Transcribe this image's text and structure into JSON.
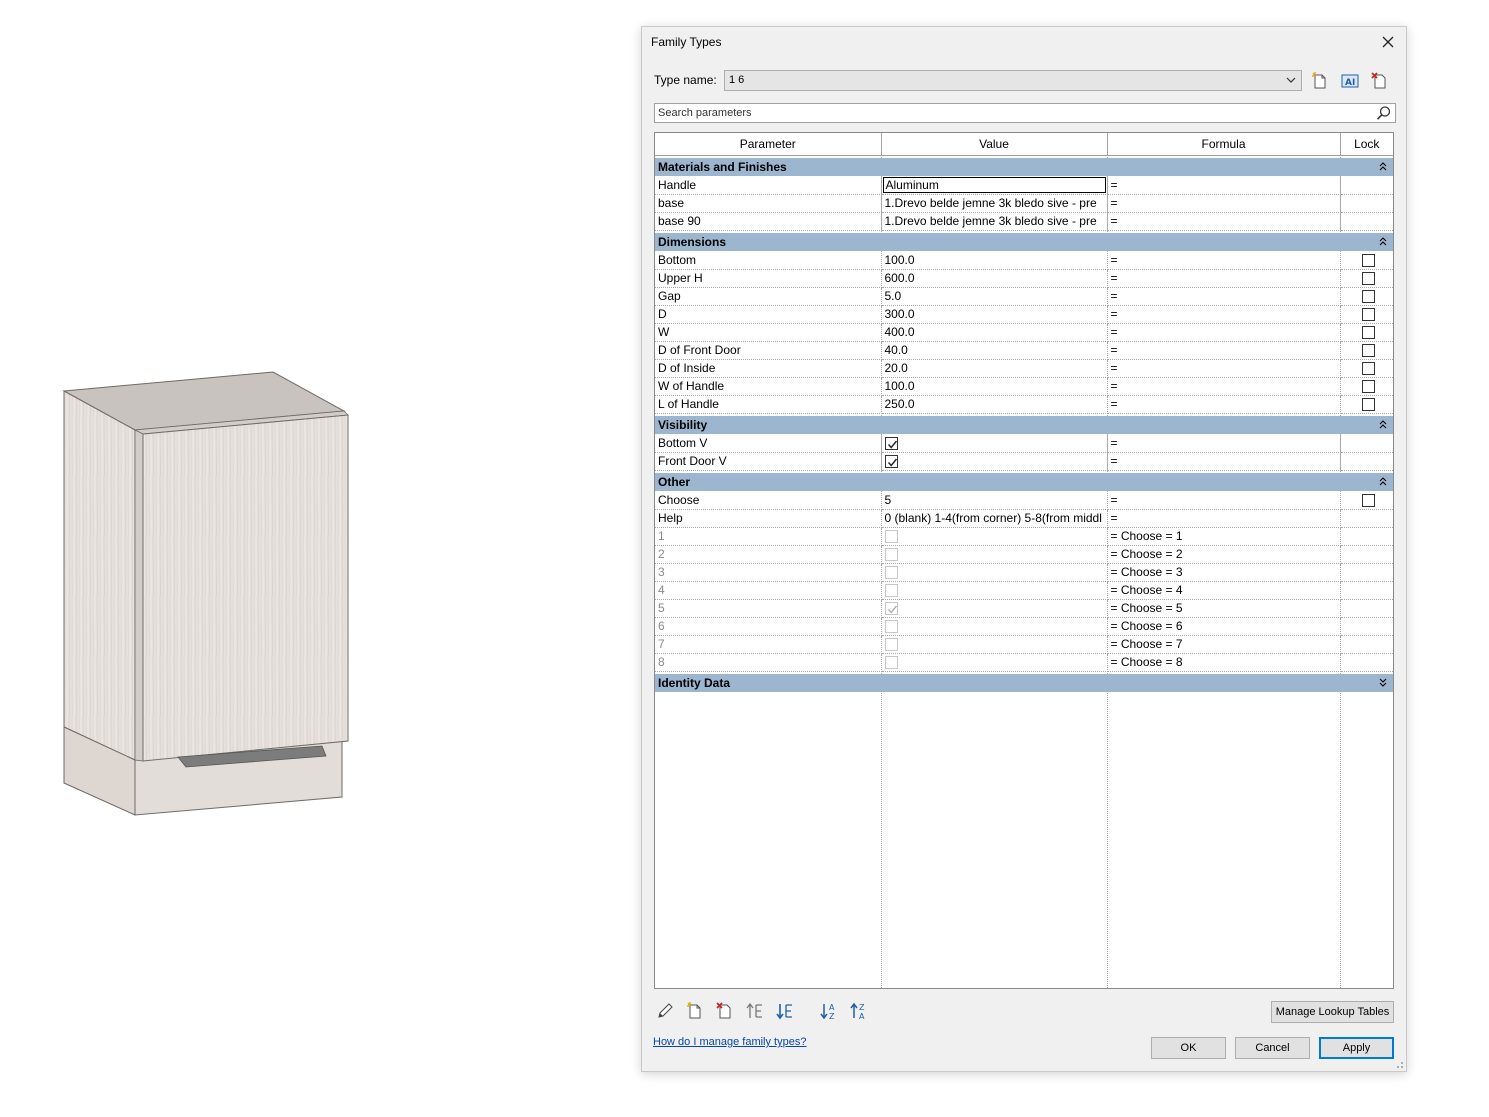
{
  "dialog": {
    "title": "Family Types",
    "type_name_label": "Type name:",
    "type_name_value": "1 6",
    "search_placeholder": "Search parameters"
  },
  "columns": {
    "parameter": "Parameter",
    "value": "Value",
    "formula": "Formula",
    "lock": "Lock"
  },
  "groups": {
    "materials": "Materials and Finishes",
    "dimensions": "Dimensions",
    "visibility": "Visibility",
    "other": "Other",
    "identity": "Identity Data"
  },
  "materials": [
    {
      "name": "Handle",
      "value": "Aluminum",
      "formula": "="
    },
    {
      "name": "base",
      "value": "1.Drevo belde jemne 3k bledo sive - pre",
      "formula": "="
    },
    {
      "name": "base 90",
      "value": "1.Drevo belde jemne 3k bledo sive - pre",
      "formula": "="
    }
  ],
  "dimensions": [
    {
      "name": "Bottom",
      "value": "100.0",
      "formula": "="
    },
    {
      "name": "Upper H",
      "value": "600.0",
      "formula": "="
    },
    {
      "name": "Gap",
      "value": "5.0",
      "formula": "="
    },
    {
      "name": "D",
      "value": "300.0",
      "formula": "="
    },
    {
      "name": "W",
      "value": "400.0",
      "formula": "="
    },
    {
      "name": "D of Front Door",
      "value": "40.0",
      "formula": "="
    },
    {
      "name": "D of Inside",
      "value": "20.0",
      "formula": "="
    },
    {
      "name": "W of Handle",
      "value": "100.0",
      "formula": "="
    },
    {
      "name": "L of Handle",
      "value": "250.0",
      "formula": "="
    }
  ],
  "visibility": [
    {
      "name": "Bottom V",
      "checked": true,
      "formula": "="
    },
    {
      "name": "Front Door V",
      "checked": true,
      "formula": "="
    }
  ],
  "other": {
    "choose": {
      "name": "Choose",
      "value": "5",
      "formula": "="
    },
    "help": {
      "name": "Help",
      "value": "0 (blank) 1-4(from corner) 5-8(from middl",
      "formula": "="
    },
    "options": [
      {
        "name": "1",
        "checked": false,
        "formula": "= Choose = 1"
      },
      {
        "name": "2",
        "checked": false,
        "formula": "= Choose = 2"
      },
      {
        "name": "3",
        "checked": false,
        "formula": "= Choose = 3"
      },
      {
        "name": "4",
        "checked": false,
        "formula": "= Choose = 4"
      },
      {
        "name": "5",
        "checked": true,
        "formula": "= Choose = 5"
      },
      {
        "name": "6",
        "checked": false,
        "formula": "= Choose = 6"
      },
      {
        "name": "7",
        "checked": false,
        "formula": "= Choose = 7"
      },
      {
        "name": "8",
        "checked": false,
        "formula": "= Choose = 8"
      }
    ]
  },
  "footer": {
    "manage_lookup": "Manage Lookup Tables",
    "help_link": "How do I manage family types?",
    "ok": "OK",
    "cancel": "Cancel",
    "apply": "Apply"
  },
  "colors": {
    "group_header": "#9db6cf",
    "link": "#0645ad",
    "apply_border": "#0078d7"
  }
}
